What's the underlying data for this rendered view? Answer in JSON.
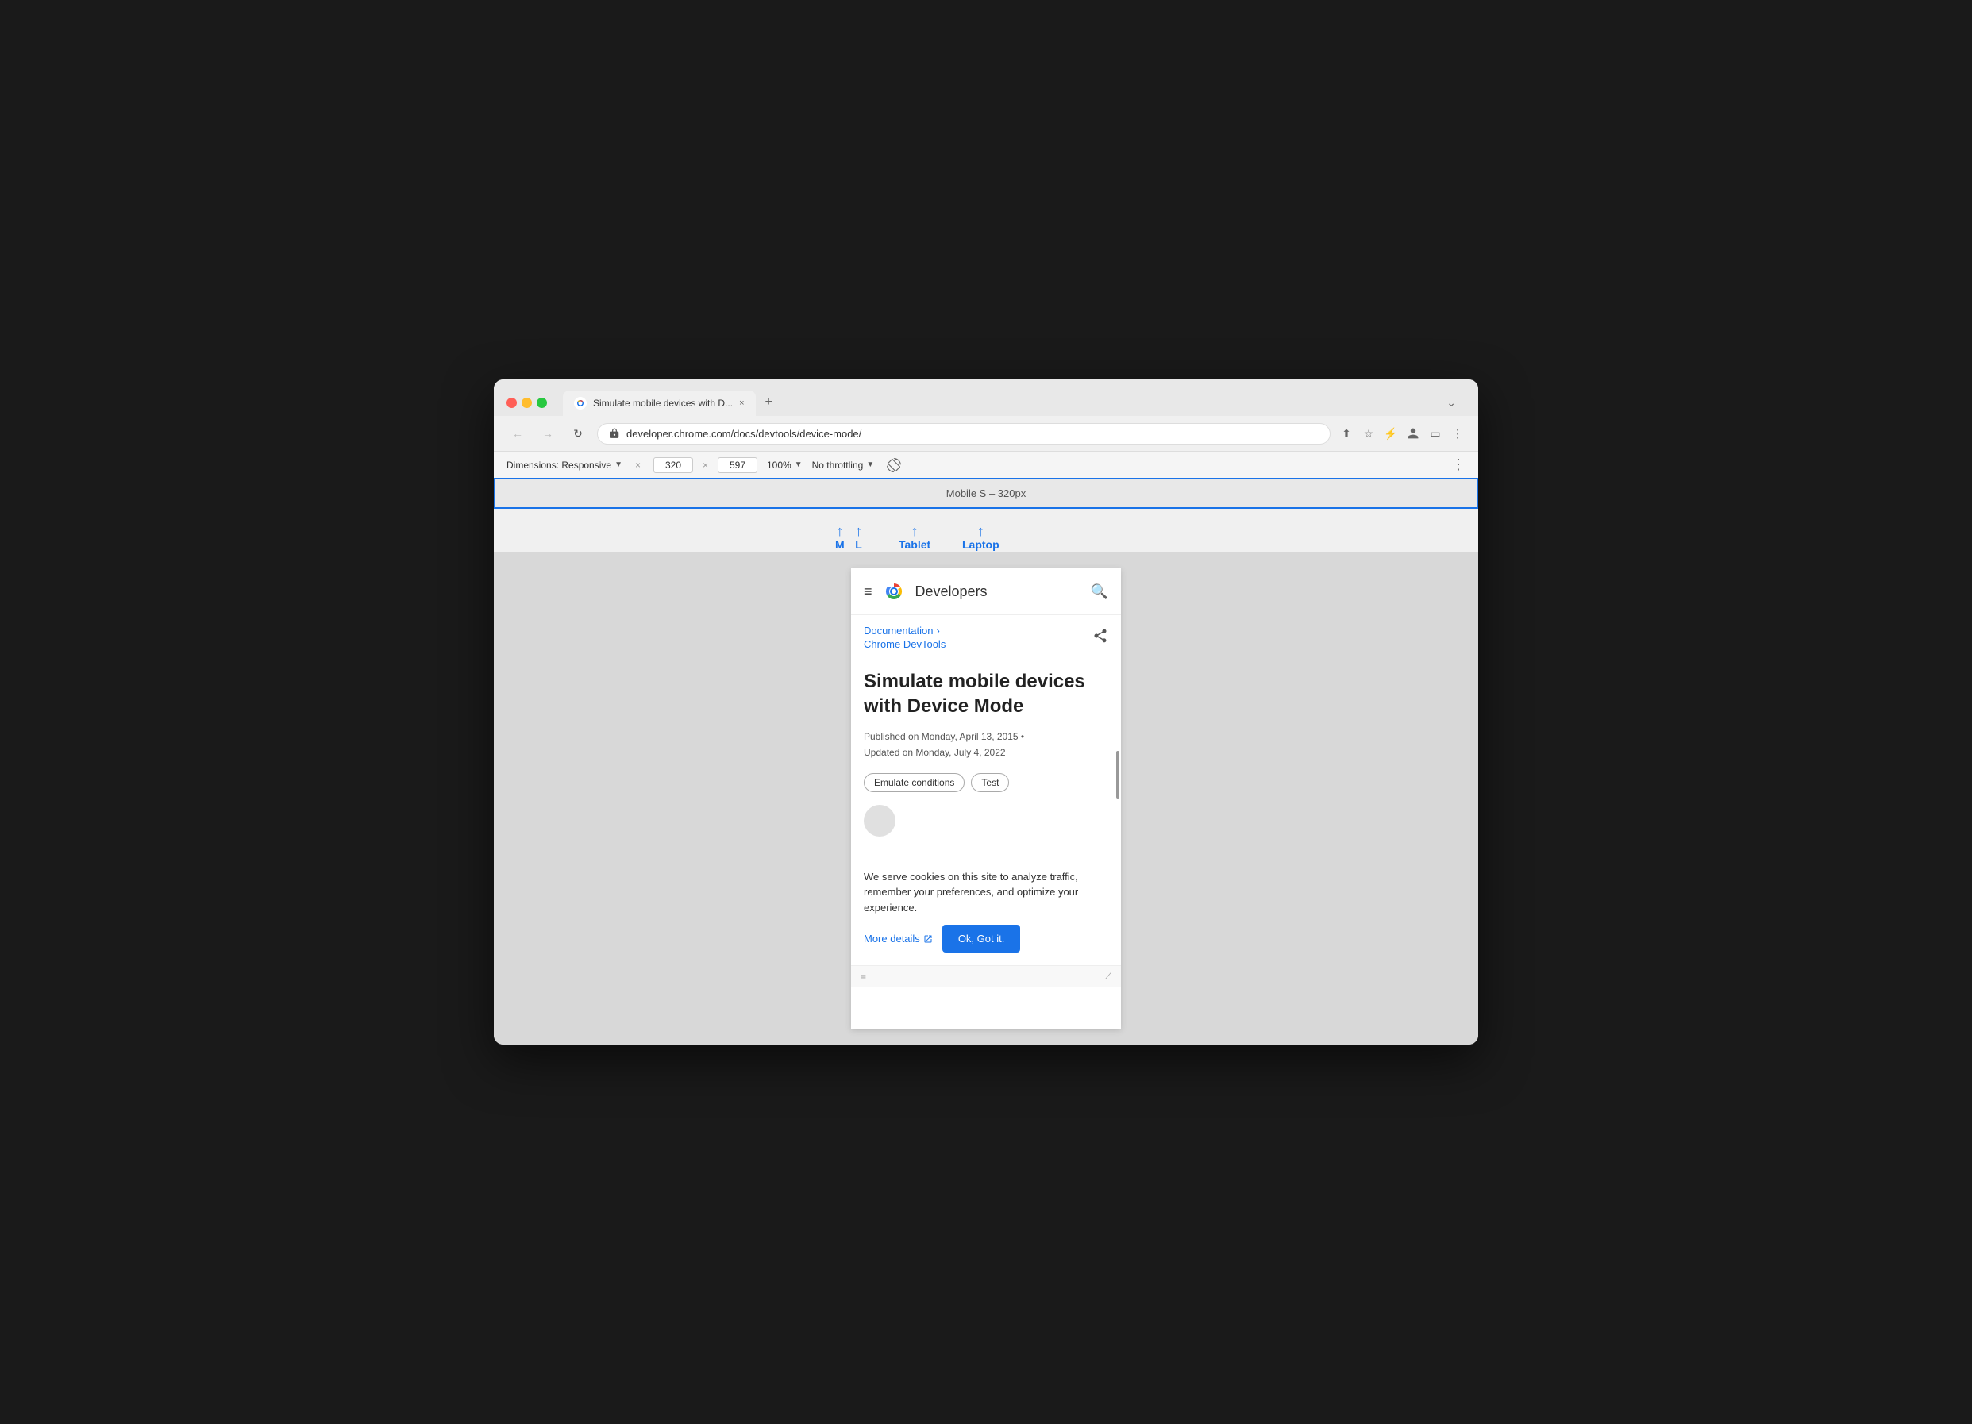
{
  "browser": {
    "tab_title": "Simulate mobile devices with D...",
    "tab_close": "×",
    "tab_new": "+",
    "tab_menu": "⌄",
    "nav_back": "←",
    "nav_forward": "→",
    "nav_refresh": "↻",
    "address": "developer.chrome.com/docs/devtools/device-mode/",
    "nav_icons": [
      "⬆",
      "☆",
      "⚡",
      "🔒",
      "▭",
      "👤",
      "⋮"
    ]
  },
  "devtools": {
    "dimensions_label": "Dimensions: Responsive",
    "width_value": "320",
    "height_value": "597",
    "zoom_label": "100%",
    "throttle_label": "No throttling",
    "more": "⋮"
  },
  "responsive_bar": {
    "label": "Mobile S – 320px"
  },
  "breakpoints": [
    {
      "id": "M",
      "label": "M"
    },
    {
      "id": "L",
      "label": "L"
    },
    {
      "id": "Tablet",
      "label": "Tablet"
    },
    {
      "id": "Laptop",
      "label": "Laptop"
    }
  ],
  "page": {
    "hamburger": "≡",
    "site_name": "Developers",
    "breadcrumb_1": "Documentation",
    "breadcrumb_chevron": "›",
    "breadcrumb_2": "Chrome DevTools",
    "article_title": "Simulate mobile devices with Device Mode",
    "published": "Published on Monday, April 13, 2015 •",
    "updated": "Updated on Monday, July 4, 2022",
    "tag_1": "Emulate conditions",
    "tag_2": "Test",
    "cookie_text": "We serve cookies on this site to analyze traffic, remember your preferences, and optimize your experience.",
    "more_details": "More details",
    "ok_button": "Ok, Got it."
  }
}
